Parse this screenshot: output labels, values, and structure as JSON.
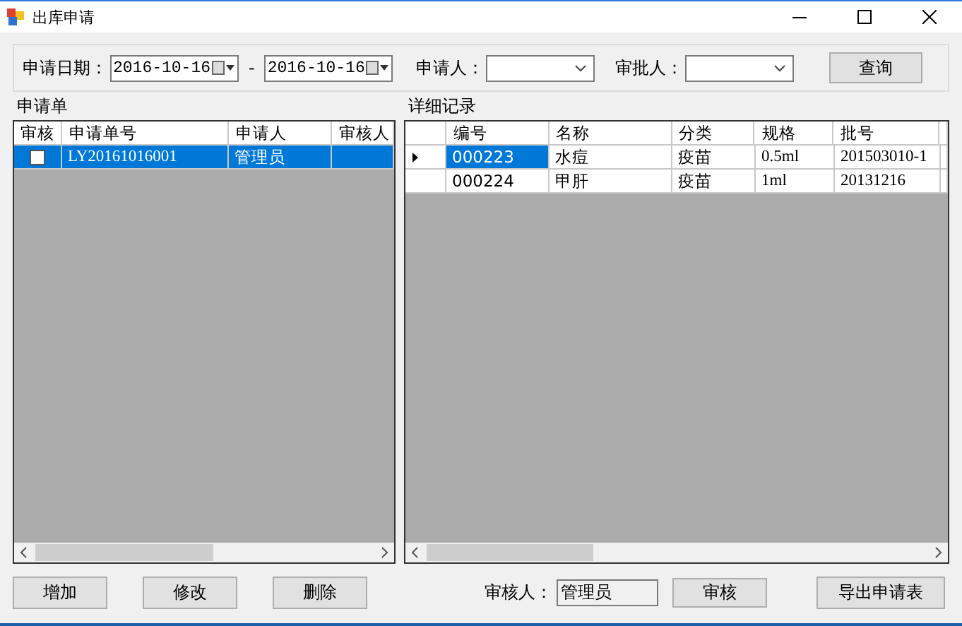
{
  "window": {
    "title": "出库申请"
  },
  "filter": {
    "date_label": "申请日期：",
    "date_from": "2016-10-16",
    "separator": "-",
    "date_to": "2016-10-16",
    "applicant_label": "申请人：",
    "approver_label": "审批人：",
    "query_button": "查询"
  },
  "requests": {
    "title": "申请单",
    "columns": [
      "审核",
      "申请单号",
      "申请人",
      "审核人"
    ],
    "rows": [
      {
        "checked": false,
        "selected": true,
        "number": "LY20161016001",
        "applicant": "管理员",
        "reviewer": ""
      }
    ]
  },
  "details": {
    "title": "详细记录",
    "columns": [
      "编号",
      "名称",
      "分类",
      "规格",
      "批号"
    ],
    "rows": [
      {
        "current": true,
        "cells": [
          "000223",
          "水痘",
          "疫苗",
          "0.5ml",
          "201503010-1"
        ]
      },
      {
        "current": false,
        "cells": [
          "000224",
          "甲肝",
          "疫苗",
          "1ml",
          "20131216"
        ]
      }
    ]
  },
  "bottom": {
    "buttons": [
      "增加",
      "修改",
      "删除"
    ],
    "reviewer_label": "审核人：",
    "reviewer_value": "管理员",
    "review_button": "审核",
    "export_button": "导出申请表"
  }
}
